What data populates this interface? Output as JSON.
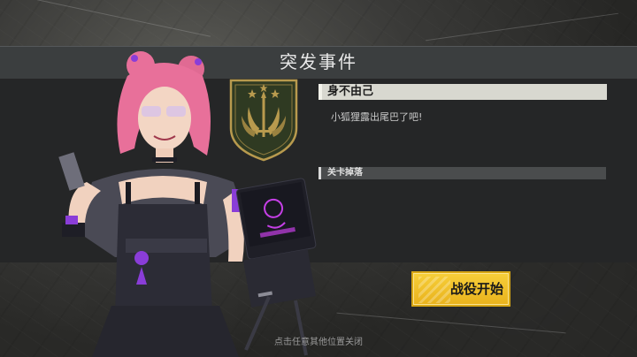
{
  "dialog": {
    "title": "突发事件",
    "event_name": "身不由己",
    "event_description": "小狐狸露出尾巴了吧!",
    "drops_section_label": "关卡掉落",
    "start_button_label": "战役开始",
    "dismiss_hint": "点击任意其他位置关闭"
  },
  "colors": {
    "accent_button": "#f0c02a",
    "emblem_green": "#2f3a22",
    "emblem_gold": "#b89a4e",
    "character_hair": "#e8709a",
    "character_accent": "#8a3dd8"
  },
  "icons": {
    "faction_emblem": "faction-emblem-icon",
    "button_deco": "stripes-deco-icon"
  }
}
